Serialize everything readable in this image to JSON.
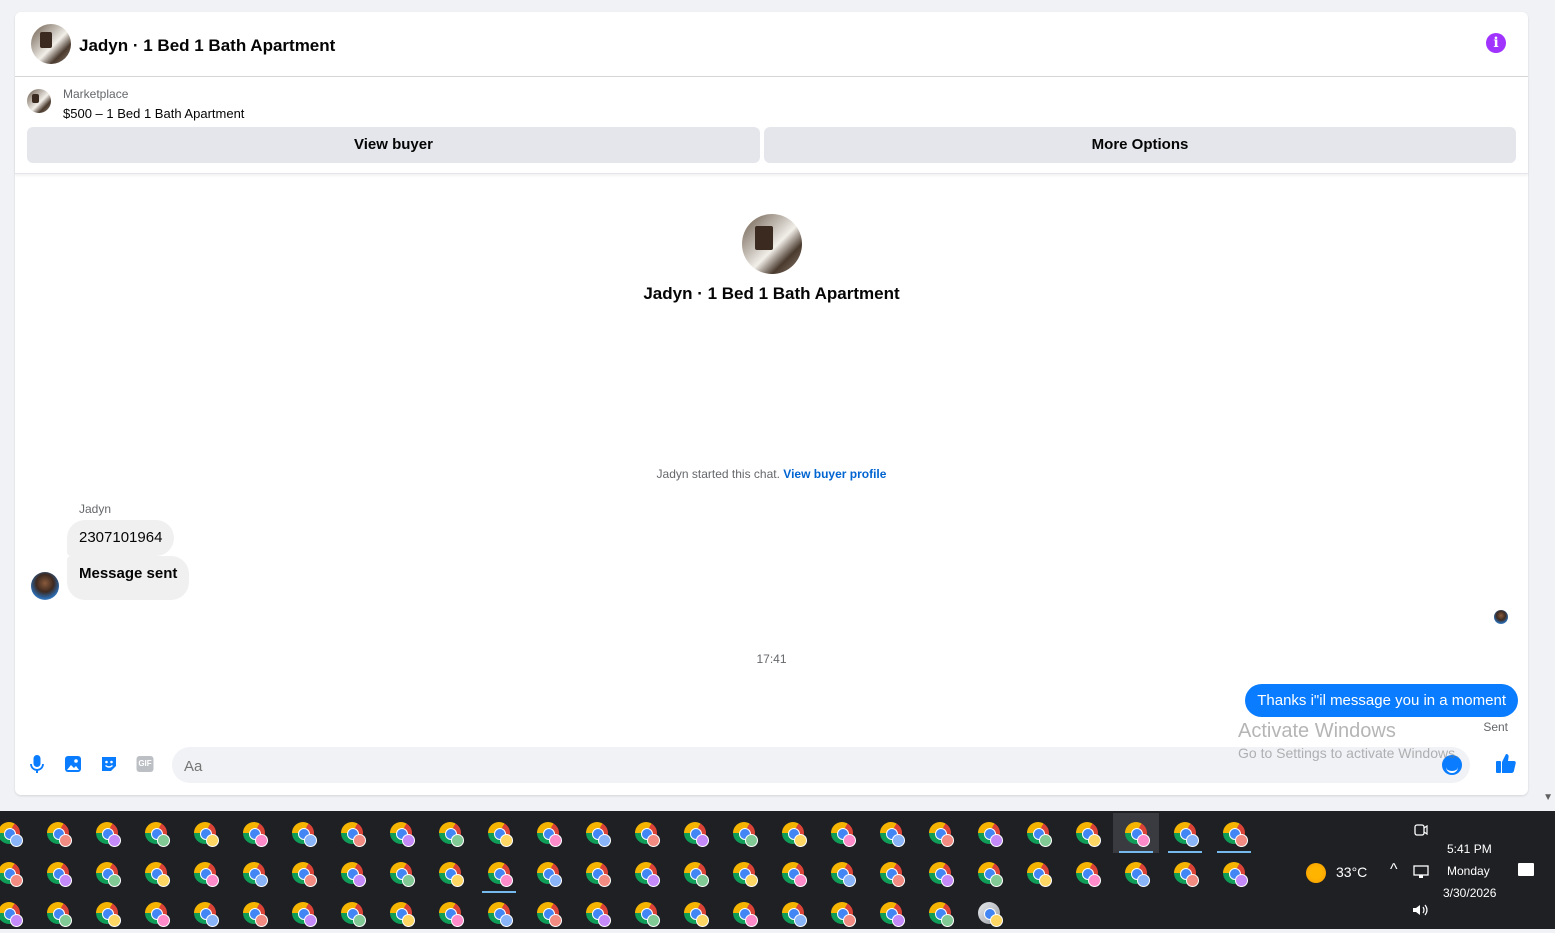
{
  "header": {
    "title": "Jadyn · 1 Bed 1 Bath Apartment",
    "info_icon": "info-icon"
  },
  "listing": {
    "source": "Marketplace",
    "price_title": "$500 – 1 Bed 1 Bath Apartment",
    "view_buyer_label": "View buyer",
    "more_options_label": "More Options"
  },
  "thread": {
    "title": "Jadyn · 1 Bed 1 Bath Apartment",
    "started_text": "Jadyn started this chat.",
    "view_profile_link": "View buyer profile",
    "sender_name": "Jadyn",
    "incoming": [
      "2307101964",
      "Message sent"
    ],
    "timestamp": "17:41",
    "outgoing": "Thanks i\"il message you in a moment",
    "status": "Sent"
  },
  "composer": {
    "placeholder": "Aa",
    "icons": [
      "microphone-icon",
      "image-icon",
      "sticker-icon",
      "gif-icon",
      "emoji-icon",
      "thumbs-up-icon"
    ],
    "gif_label": "GIF"
  },
  "watermark": {
    "line1": "Activate Windows",
    "line2": "Go to Settings to activate Windows."
  },
  "taskbar": {
    "weather": "33°C",
    "time": "5:41 PM",
    "day": "Monday",
    "date": "3/30/2026"
  }
}
